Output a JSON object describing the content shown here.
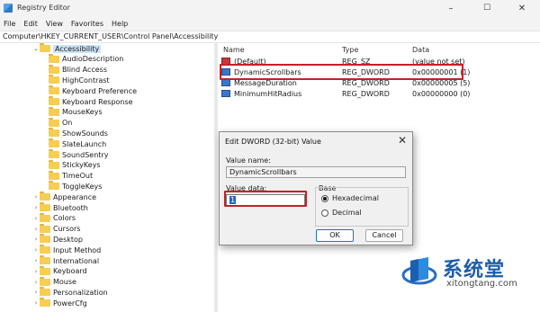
{
  "window": {
    "title": "Registry Editor",
    "minimize": "–",
    "maximize": "☐",
    "close": "✕"
  },
  "menu": [
    "File",
    "Edit",
    "View",
    "Favorites",
    "Help"
  ],
  "address": "Computer\\HKEY_CURRENT_USER\\Control Panel\\Accessibility",
  "tree": {
    "selected": "Accessibility",
    "children": [
      "AudioDescription",
      "Blind Access",
      "HighContrast",
      "Keyboard Preference",
      "Keyboard Response",
      "MouseKeys",
      "On",
      "ShowSounds",
      "SlateLaunch",
      "SoundSentry",
      "StickyKeys",
      "TimeOut",
      "ToggleKeys"
    ],
    "siblings": [
      "Appearance",
      "Bluetooth",
      "Colors",
      "Cursors",
      "Desktop",
      "Input Method",
      "International",
      "Keyboard",
      "Mouse",
      "Personalization",
      "PowerCfg"
    ]
  },
  "values": {
    "headers": {
      "name": "Name",
      "type": "Type",
      "data": "Data"
    },
    "rows": [
      {
        "name": "(Default)",
        "type": "REG_SZ",
        "data": "(value not set)",
        "icon": "string-value-icon"
      },
      {
        "name": "DynamicScrollbars",
        "type": "REG_DWORD",
        "data": "0x00000001 (1)",
        "icon": "dword-value-icon"
      },
      {
        "name": "MessageDuration",
        "type": "REG_DWORD",
        "data": "0x00000005 (5)",
        "icon": "dword-value-icon"
      },
      {
        "name": "MinimumHitRadius",
        "type": "REG_DWORD",
        "data": "0x00000000 (0)",
        "icon": "dword-value-icon"
      }
    ]
  },
  "dialog": {
    "title": "Edit DWORD (32-bit) Value",
    "close": "✕",
    "value_name_label": "Value name:",
    "value_name": "DynamicScrollbars",
    "value_data_label": "Value data:",
    "value_data": "1",
    "base_label": "Base",
    "base_options": [
      "Hexadecimal",
      "Decimal"
    ],
    "base_selected": "Hexadecimal",
    "ok": "OK",
    "cancel": "Cancel"
  },
  "colors": {
    "highlight": "#c4202a",
    "selection": "#cce4f7",
    "folder": "#f7cd52"
  },
  "watermark": {
    "brand": "系统堂",
    "url": "xitongtang.com"
  }
}
